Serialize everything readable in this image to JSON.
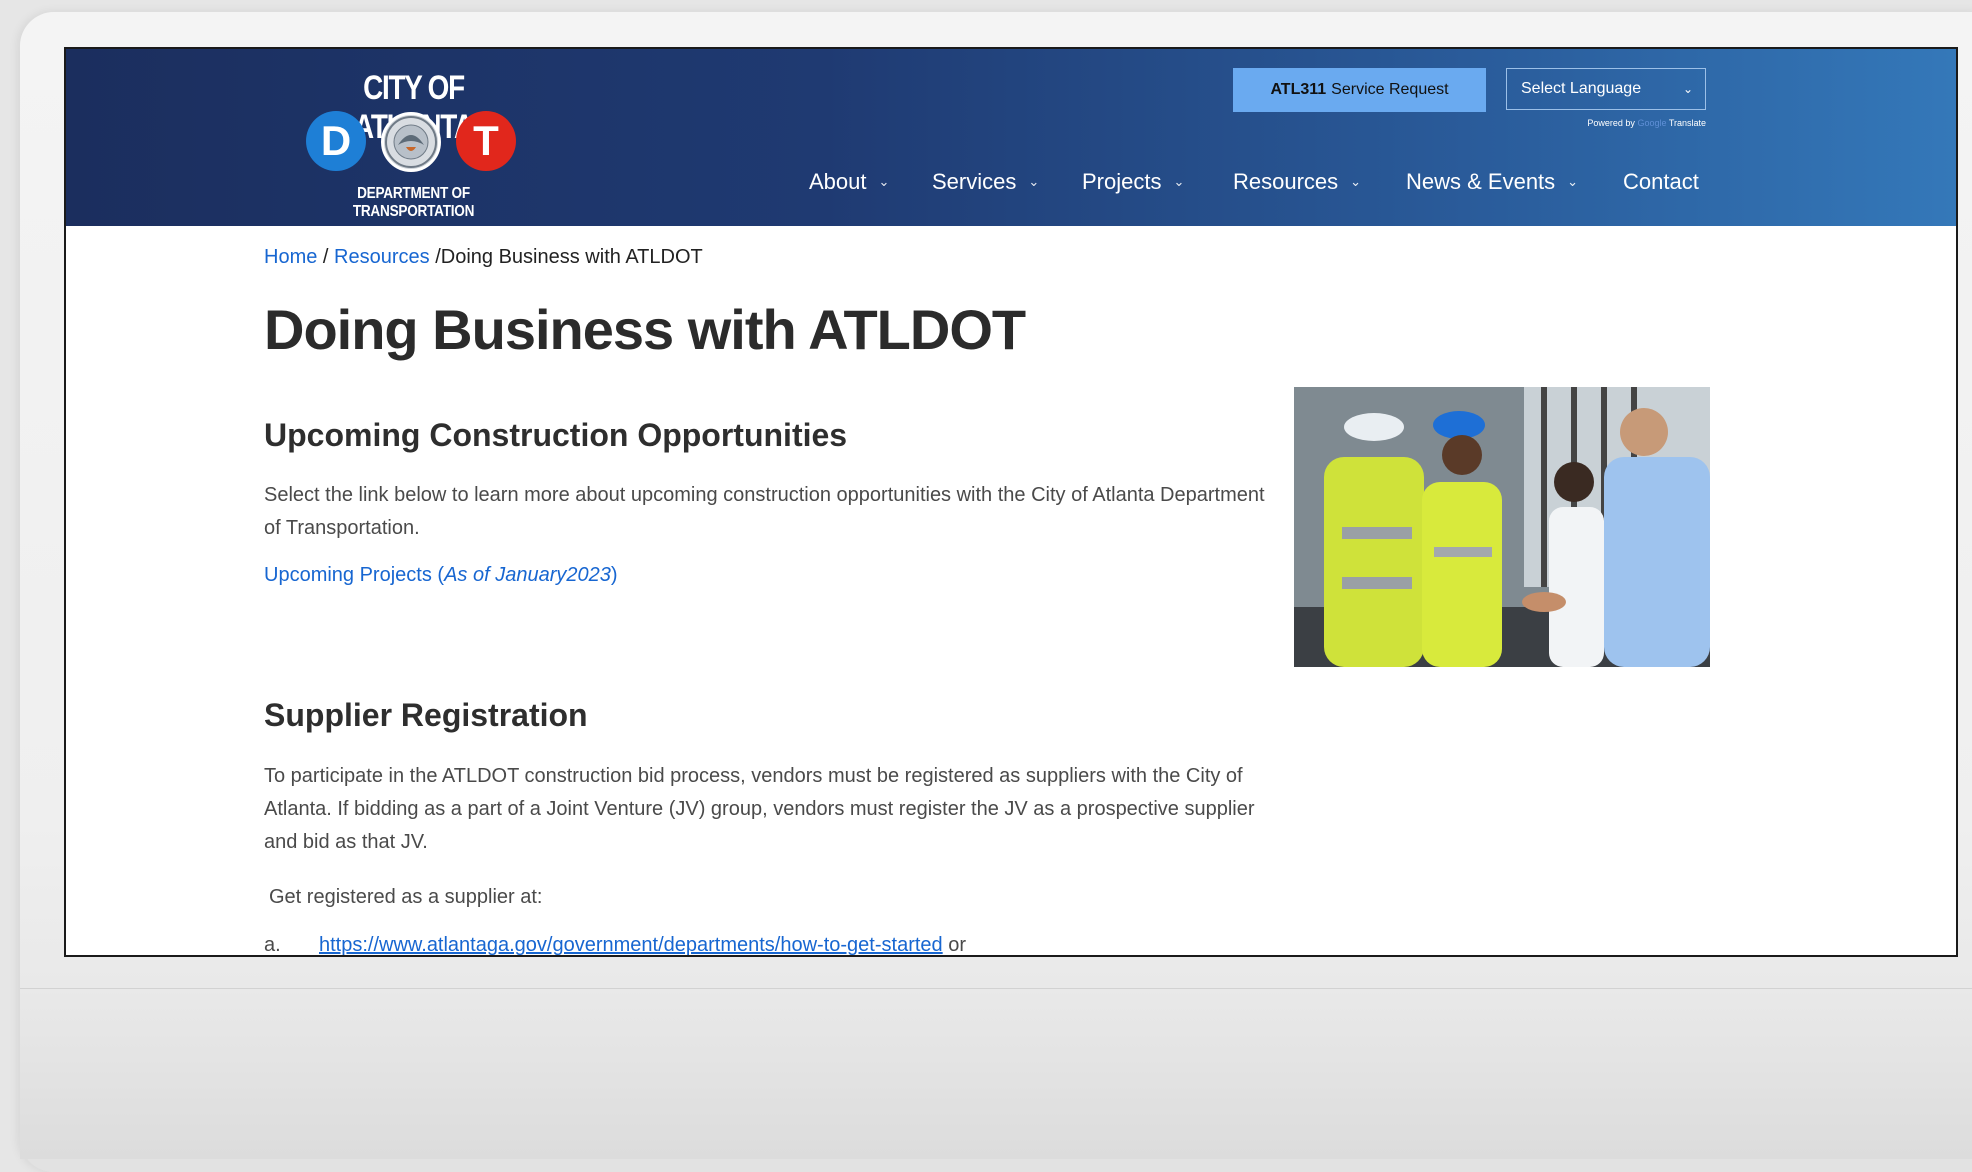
{
  "header": {
    "logo": {
      "title": "CITY OF ATLANTA",
      "letter_left": "D",
      "letter_right": "T",
      "subtitle": "DEPARTMENT OF TRANSPORTATION"
    },
    "atl311_bold": "ATL311",
    "atl311_rest": "Service Request",
    "language_select": "Select Language",
    "powered_by": "Powered by",
    "powered_google": "Google",
    "powered_translate": "Translate",
    "nav": [
      {
        "label": "About",
        "has_dropdown": true
      },
      {
        "label": "Services",
        "has_dropdown": true
      },
      {
        "label": "Projects",
        "has_dropdown": true
      },
      {
        "label": "Resources",
        "has_dropdown": true
      },
      {
        "label": "News & Events",
        "has_dropdown": true
      },
      {
        "label": "Contact",
        "has_dropdown": false
      }
    ]
  },
  "breadcrumb": {
    "home": "Home",
    "sep1": "/",
    "resources": "Resources",
    "sep2": "/",
    "current": "Doing Business with ATLDOT"
  },
  "page_title": "Doing Business with ATLDOT",
  "sections": {
    "construction": {
      "heading": "Upcoming Construction Opportunities",
      "body": "Select the link below to learn more about upcoming construction opportunities with the City of Atlanta Department of Transportation.",
      "link_text": "Upcoming Projects (",
      "link_italic": "As of January2023",
      "link_close": ")"
    },
    "supplier": {
      "heading": "Supplier Registration",
      "body": "To participate in the ATLDOT construction bid process, vendors must be registered as suppliers with the City of Atlanta. If bidding as a part of a Joint Venture (JV) group, vendors must register the JV as a prospective supplier and bid as that JV.",
      "get_registered": "Get registered as a supplier at:",
      "item_marker": "a.",
      "item_link": "https://www.atlantaga.gov/government/departments/how-to-get-started",
      "item_suffix": "or"
    }
  },
  "colors": {
    "header_left": "#1b2e5e",
    "header_right": "#3478b9",
    "link": "#1766d1",
    "atl311_bg": "#6aaaf0",
    "logo_d": "#1e7fd6",
    "logo_t": "#e1271c"
  }
}
